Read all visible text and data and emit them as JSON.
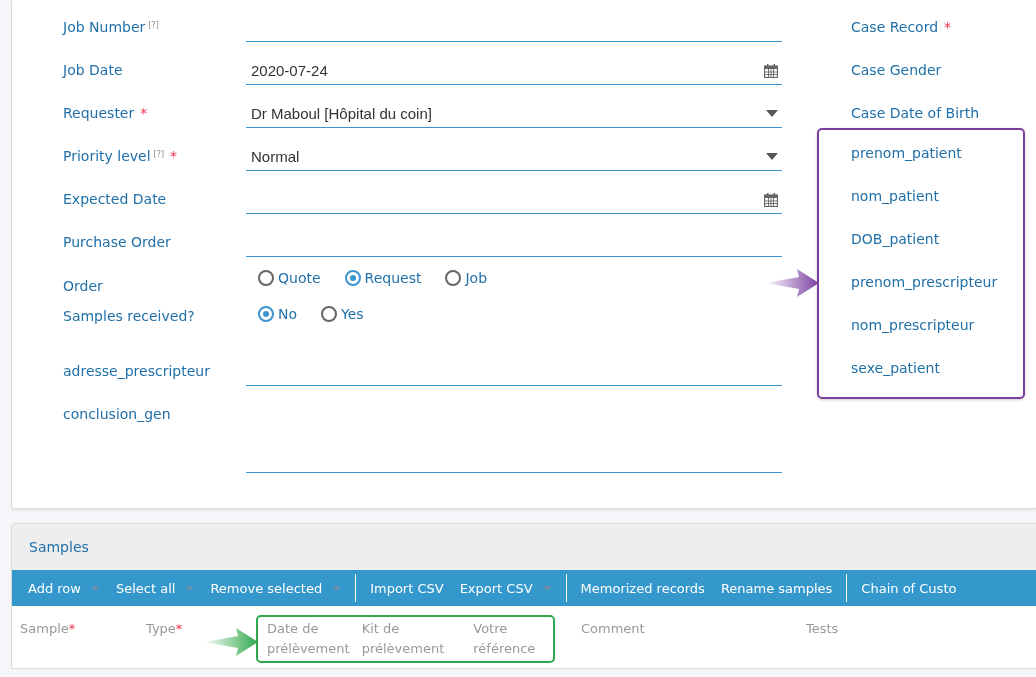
{
  "job_form": {
    "fields": [
      {
        "kind": "text",
        "label": "Job Number",
        "help": "[?]"
      },
      {
        "kind": "date",
        "label": "Job Date",
        "value": "2020-07-24"
      },
      {
        "kind": "select",
        "label": "Requester",
        "required": "*",
        "value": "Dr Maboul [Hôpital du coin]"
      },
      {
        "kind": "select",
        "label": "Priority level",
        "help": "[?]",
        "required": "*",
        "value": "Normal"
      },
      {
        "kind": "date",
        "label": "Expected Date"
      },
      {
        "kind": "text",
        "label": "Purchase Order"
      },
      {
        "kind": "radio",
        "label": "Order",
        "options": [
          {
            "label": "Quote",
            "selected": false
          },
          {
            "label": "Request",
            "selected": true
          },
          {
            "label": "Job",
            "selected": false
          }
        ]
      },
      {
        "kind": "radio",
        "label": "Samples received?",
        "options": [
          {
            "label": "No",
            "selected": true
          },
          {
            "label": "Yes",
            "selected": false
          }
        ]
      },
      {
        "kind": "text",
        "label": "adresse_prescripteur"
      },
      {
        "kind": "textarea",
        "label": "conclusion_gen"
      }
    ]
  },
  "case_fields": {
    "fields": [
      {
        "label": "Case Record",
        "required": "*"
      },
      {
        "label": "Case Gender"
      },
      {
        "label": "Case Date of Birth"
      }
    ],
    "highlighted_fields": [
      {
        "label": "prenom_patient"
      },
      {
        "label": "nom_patient"
      },
      {
        "label": "DOB_patient"
      },
      {
        "label": "prenom_prescripteur"
      },
      {
        "label": "nom_prescripteur"
      },
      {
        "label": "sexe_patient"
      }
    ]
  },
  "samples": {
    "title": "Samples",
    "toolbar": [
      {
        "kind": "split",
        "label": "Add row"
      },
      {
        "kind": "split",
        "label": "Select all"
      },
      {
        "kind": "split",
        "label": "Remove selected"
      },
      {
        "kind": "separator"
      },
      {
        "kind": "button",
        "label": "Import CSV"
      },
      {
        "kind": "split",
        "label": "Export CSV"
      },
      {
        "kind": "separator"
      },
      {
        "kind": "button",
        "label": "Memorized records"
      },
      {
        "kind": "button",
        "label": "Rename samples"
      },
      {
        "kind": "separator"
      },
      {
        "kind": "button",
        "label": "Chain of Custo"
      }
    ],
    "columns_before": [
      {
        "label": "Sample",
        "required": "*"
      },
      {
        "label": "Type",
        "required": "*"
      }
    ],
    "highlighted_columns": [
      {
        "label": "Date de prélèvement"
      },
      {
        "label": "Kit de prélèvement"
      },
      {
        "label": "Votre référence"
      }
    ],
    "columns_after": [
      {
        "label": "Comment"
      },
      {
        "label": "Tests"
      }
    ]
  }
}
